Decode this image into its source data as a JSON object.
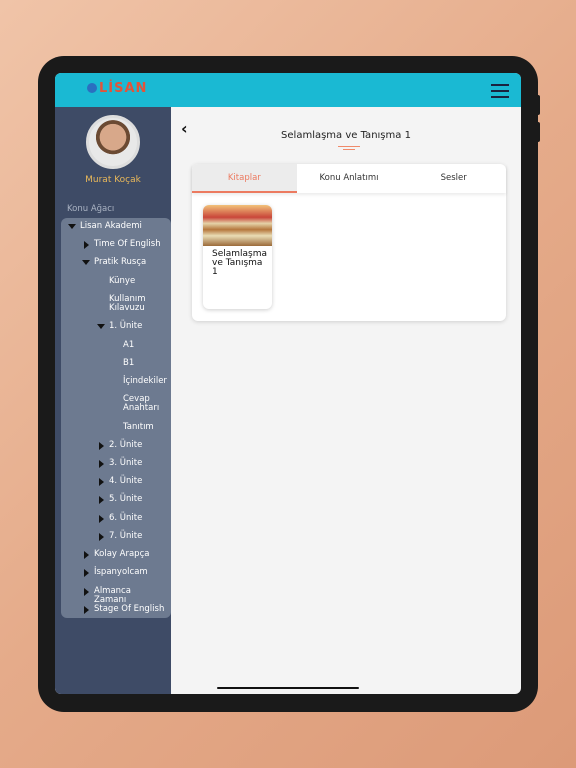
{
  "header": {
    "logo": "LİSAN",
    "menu_icon": "hamburger-icon",
    "color": "#1ab9d3"
  },
  "sidebar": {
    "user_name": "Murat Koçak",
    "tree_title": "Konu Ağacı",
    "tree": [
      {
        "label": "Lisan Akademi",
        "level": 0,
        "state": "expanded"
      },
      {
        "label": "Time Of English",
        "level": 1,
        "state": "collapsed"
      },
      {
        "label": "Pratik Rusça",
        "level": 1,
        "state": "expanded"
      },
      {
        "label": "Künye",
        "level": 2,
        "state": "leaf"
      },
      {
        "label": "Kullanım Kılavuzu",
        "level": 2,
        "state": "leaf"
      },
      {
        "label": "1. Ünite",
        "level": 2,
        "state": "expanded"
      },
      {
        "label": "A1",
        "level": 3,
        "state": "leaf"
      },
      {
        "label": "B1",
        "level": 3,
        "state": "leaf"
      },
      {
        "label": "İçindekiler",
        "level": 3,
        "state": "leaf"
      },
      {
        "label": "Cevap Anahtarı",
        "level": 3,
        "state": "leaf"
      },
      {
        "label": "Tanıtım",
        "level": 3,
        "state": "leaf"
      },
      {
        "label": "2. Ünite",
        "level": 2,
        "state": "collapsed"
      },
      {
        "label": "3. Ünite",
        "level": 2,
        "state": "collapsed"
      },
      {
        "label": "4. Ünite",
        "level": 2,
        "state": "collapsed"
      },
      {
        "label": "5. Ünite",
        "level": 2,
        "state": "collapsed"
      },
      {
        "label": "6. Ünite",
        "level": 2,
        "state": "collapsed"
      },
      {
        "label": "7. Ünite",
        "level": 2,
        "state": "collapsed"
      },
      {
        "label": "Kolay Arapça",
        "level": 1,
        "state": "collapsed"
      },
      {
        "label": "İspanyolcam",
        "level": 1,
        "state": "collapsed"
      },
      {
        "label": "Almanca Zamanı",
        "level": 1,
        "state": "collapsed"
      },
      {
        "label": "Stage Of English",
        "level": 1,
        "state": "collapsed"
      }
    ]
  },
  "main": {
    "back": "‹",
    "title": "Selamlaşma ve Tanışma 1",
    "tabs": [
      "Kitaplar",
      "Konu Anlatımı",
      "Sesler"
    ],
    "active_tab": "Kitaplar",
    "books": [
      {
        "title": "Selamlaşma ve Tanışma 1"
      }
    ]
  }
}
